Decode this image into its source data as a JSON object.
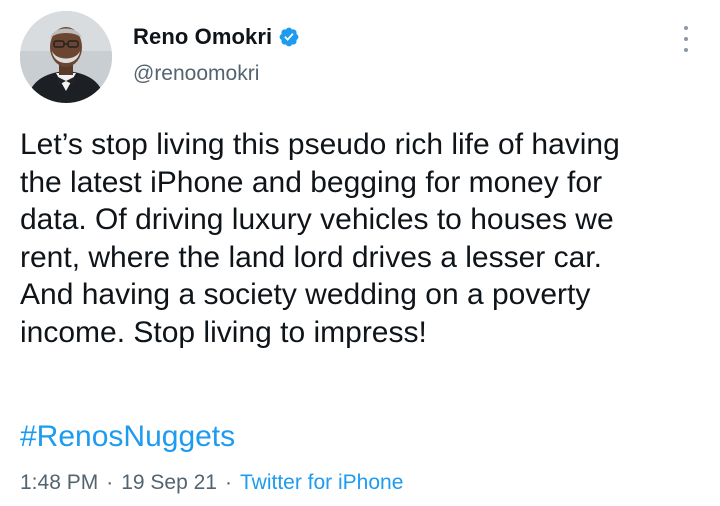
{
  "user": {
    "display_name": "Reno Omokri",
    "handle": "@renoomokri",
    "verified": true
  },
  "tweet": {
    "lines": [
      "Let’s stop living this pseudo rich life of having",
      "the latest iPhone and begging for money for",
      "data. Of driving luxury vehicles to houses we",
      "rent, where the land lord drives a lesser car.",
      "And having a society wedding on a poverty",
      "income. Stop living to impress!"
    ],
    "hashtag": "#RenosNuggets",
    "time": "1:48 PM",
    "separator": "·",
    "date": "19 Sep 21",
    "source": "Twitter for iPhone"
  },
  "icons": {
    "verified": "verified-badge-icon",
    "more": "more-options-icon"
  },
  "colors": {
    "text_primary": "#0f1419",
    "text_secondary": "#536471",
    "link": "#1d9bf0",
    "verified_badge": "#1d9bf0"
  }
}
